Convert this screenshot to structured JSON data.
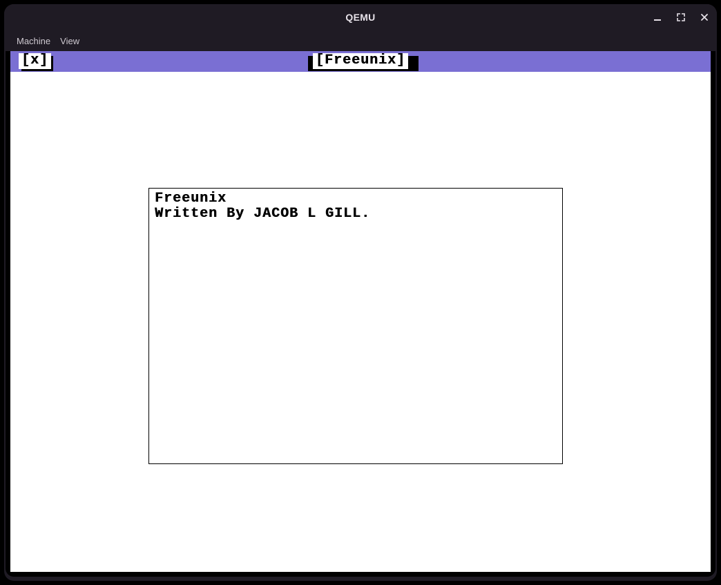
{
  "window": {
    "title": "QEMU"
  },
  "menubar": {
    "items": [
      {
        "label": "Machine"
      },
      {
        "label": "View"
      }
    ]
  },
  "guest": {
    "header": {
      "close_label": "[x]",
      "title_label": "[Freeunix]"
    },
    "panel": {
      "line1": "Freeunix",
      "line2": "Written By JACOB L GILL."
    }
  }
}
